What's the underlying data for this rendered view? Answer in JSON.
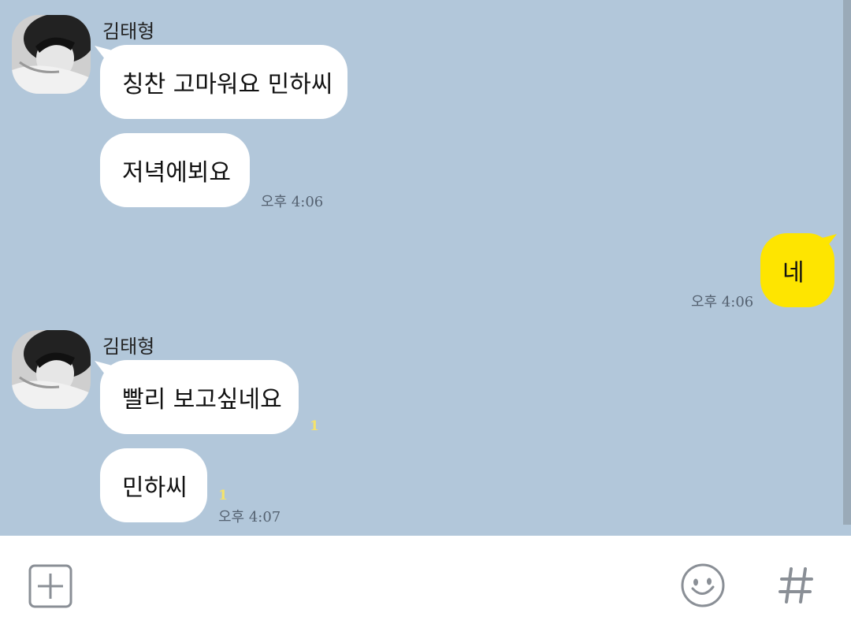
{
  "messages": [
    {
      "sender": "김태형",
      "text": "칭찬 고마워요 민하씨"
    },
    {
      "text": "저녁에뵈요",
      "time": "오후 4:06"
    },
    {
      "text": "네",
      "time": "오후 4:06",
      "mine": true
    },
    {
      "sender": "김태형",
      "text": "빨리 보고싶네요",
      "unread": "1"
    },
    {
      "text": "민하씨",
      "unread": "1",
      "time": "오후 4:07"
    }
  ],
  "input_bar": {
    "add_icon": "plus-square-icon",
    "emoji_icon": "smiley-icon",
    "hashtag_icon": "hashtag-icon"
  },
  "colors": {
    "chat_background": "#b2c7da",
    "my_bubble": "#fee500",
    "other_bubble": "#ffffff",
    "unread": "#f5e36a"
  }
}
